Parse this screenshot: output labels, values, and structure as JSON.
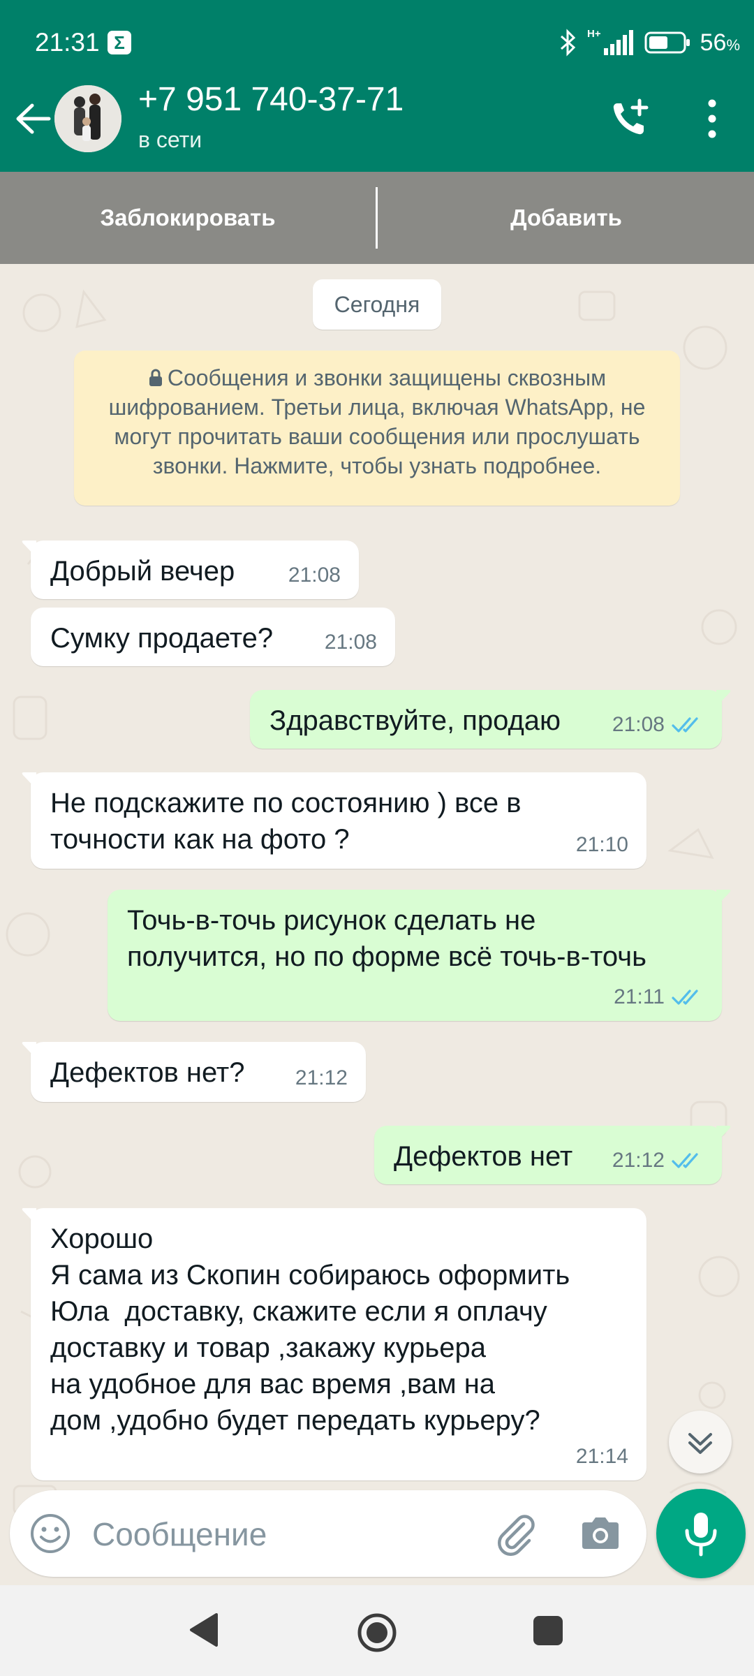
{
  "status_bar": {
    "time": "21:31",
    "notification_icon": "sigma-icon",
    "notification_glyph": "Σ",
    "network": "H+",
    "battery_percent": "56",
    "battery_unit": "%",
    "battery_level": 0.56
  },
  "header": {
    "contact_name": "+7 951 740-37-71",
    "contact_status": "в сети",
    "back_icon": "arrow-left-icon",
    "call_icon": "add-call-icon",
    "menu_icon": "more-vert-icon"
  },
  "action_bar": {
    "block_label": "Заблокировать",
    "add_label": "Добавить"
  },
  "chat": {
    "date_label": "Сегодня",
    "encryption_notice": "Сообщения и звонки защищены сквозным шифрованием. Третьи лица, включая WhatsApp, не могут прочитать ваши сообщения или прослушать звонки. Нажмите, чтобы узнать подробнее.",
    "messages": [
      {
        "direction": "in",
        "text": "Добрый вечер",
        "time": "21:08"
      },
      {
        "direction": "in",
        "text": "Сумку продаете?",
        "time": "21:08"
      },
      {
        "direction": "out",
        "text": "Здравствуйте, продаю",
        "time": "21:08",
        "status": "read"
      },
      {
        "direction": "in",
        "text": "Не подскажите по состоянию ) все в\nточности как на фото ?",
        "time": "21:10"
      },
      {
        "direction": "out",
        "text": "Точь-в-точь рисунок сделать не\nполучится, но по форме всё точь-в-точь",
        "time": "21:11",
        "status": "read"
      },
      {
        "direction": "in",
        "text": "Дефектов нет?",
        "time": "21:12"
      },
      {
        "direction": "out",
        "text": "Дефектов нет",
        "time": "21:12",
        "status": "read"
      },
      {
        "direction": "in",
        "text": "Хорошо\nЯ сама из Скопин собираюсь оформить\nЮла  доставку, скажите если я оплачу\nдоставку и товар ,закажу курьера\nна удобное для вас время ,вам на\nдом ,удобно будет передать курьеру?",
        "time": "21:14"
      }
    ]
  },
  "input_bar": {
    "placeholder": "Сообщение",
    "value": ""
  },
  "colors": {
    "header": "#008069",
    "action_bar": "#8a8a86",
    "chat_bg": "#efeae2",
    "bubble_in": "#ffffff",
    "bubble_out": "#d9fdd3",
    "read_ticks": "#53bdeb",
    "mic_button": "#00a884"
  }
}
